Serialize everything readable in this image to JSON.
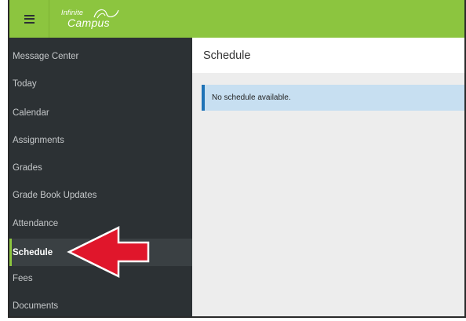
{
  "app": {
    "logo_line1": "Infinite",
    "logo_line2": "Campus"
  },
  "sidebar": {
    "items": [
      {
        "label": "Message Center",
        "active": false
      },
      {
        "label": "Today",
        "active": false
      },
      {
        "label": "Calendar",
        "active": false
      },
      {
        "label": "Assignments",
        "active": false
      },
      {
        "label": "Grades",
        "active": false
      },
      {
        "label": "Grade Book Updates",
        "active": false
      },
      {
        "label": "Attendance",
        "active": false
      },
      {
        "label": "Schedule",
        "active": true
      },
      {
        "label": "Fees",
        "active": false
      },
      {
        "label": "Documents",
        "active": false
      }
    ]
  },
  "main": {
    "page_title": "Schedule",
    "notice": "No schedule available."
  },
  "colors": {
    "topbar": "#8cc53f",
    "sidebar": "#2c3134",
    "notice_bg": "#c7dff1",
    "notice_border": "#1f73b7",
    "arrow": "#e0162b"
  },
  "icons": {
    "menu": "hamburger-menu-icon",
    "arrow": "red-arrow-annotation"
  }
}
